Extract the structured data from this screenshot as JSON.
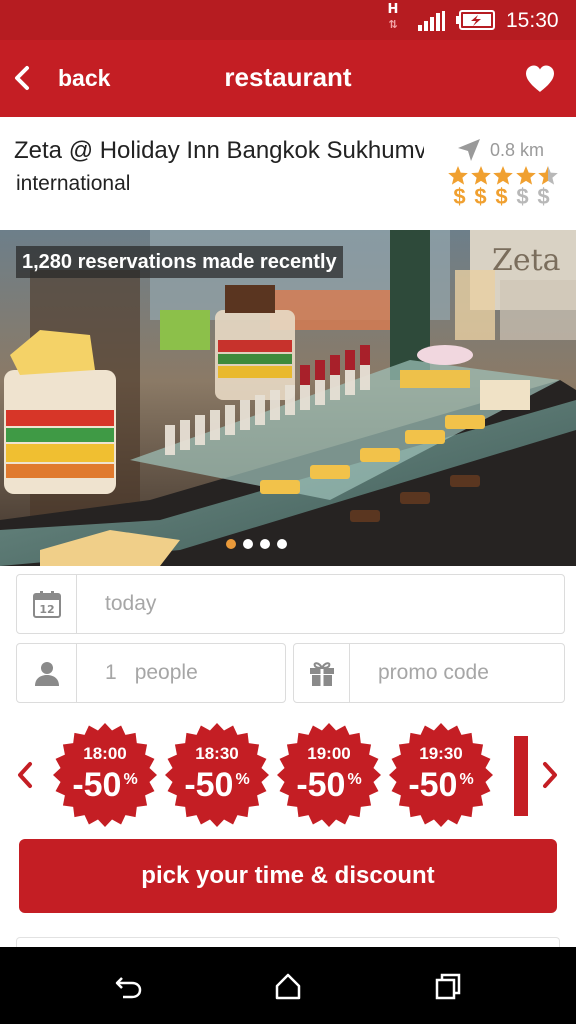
{
  "status_bar": {
    "network_type": "H",
    "time": "15:30",
    "icons": [
      "data-arrows-icon",
      "signal-icon",
      "battery-charging-icon"
    ]
  },
  "app_bar": {
    "back_label": "back",
    "title": "restaurant",
    "icons": [
      "back-chevron-icon",
      "heart-icon"
    ]
  },
  "restaurant": {
    "name": "Zeta @ Holiday Inn Bangkok Sukhumvit",
    "cuisine": "international",
    "distance": "0.8 km",
    "rating": 4.5,
    "rating_max": 5,
    "price_symbols": [
      "$",
      "$",
      "$",
      "$",
      "$"
    ],
    "price_level": 3,
    "colors": {
      "accent": "#c41e24",
      "star": "#f0a030",
      "inactive": "#b8b8b8"
    }
  },
  "hero": {
    "reservations_text": "1,280 reservations made recently",
    "slide_count": 4,
    "active_slide": 0
  },
  "booking": {
    "date_value": "today",
    "people_count": "1",
    "people_label": "people",
    "promo_placeholder": "promo code"
  },
  "time_slots": [
    {
      "time": "18:00",
      "discount": "-50",
      "unit": "%"
    },
    {
      "time": "18:30",
      "discount": "-50",
      "unit": "%"
    },
    {
      "time": "19:00",
      "discount": "-50",
      "unit": "%"
    },
    {
      "time": "19:30",
      "discount": "-50",
      "unit": "%"
    }
  ],
  "cta": {
    "label": "pick your time & discount"
  },
  "nav_bar": {
    "icons": [
      "back-nav-icon",
      "home-nav-icon",
      "recents-nav-icon"
    ]
  }
}
